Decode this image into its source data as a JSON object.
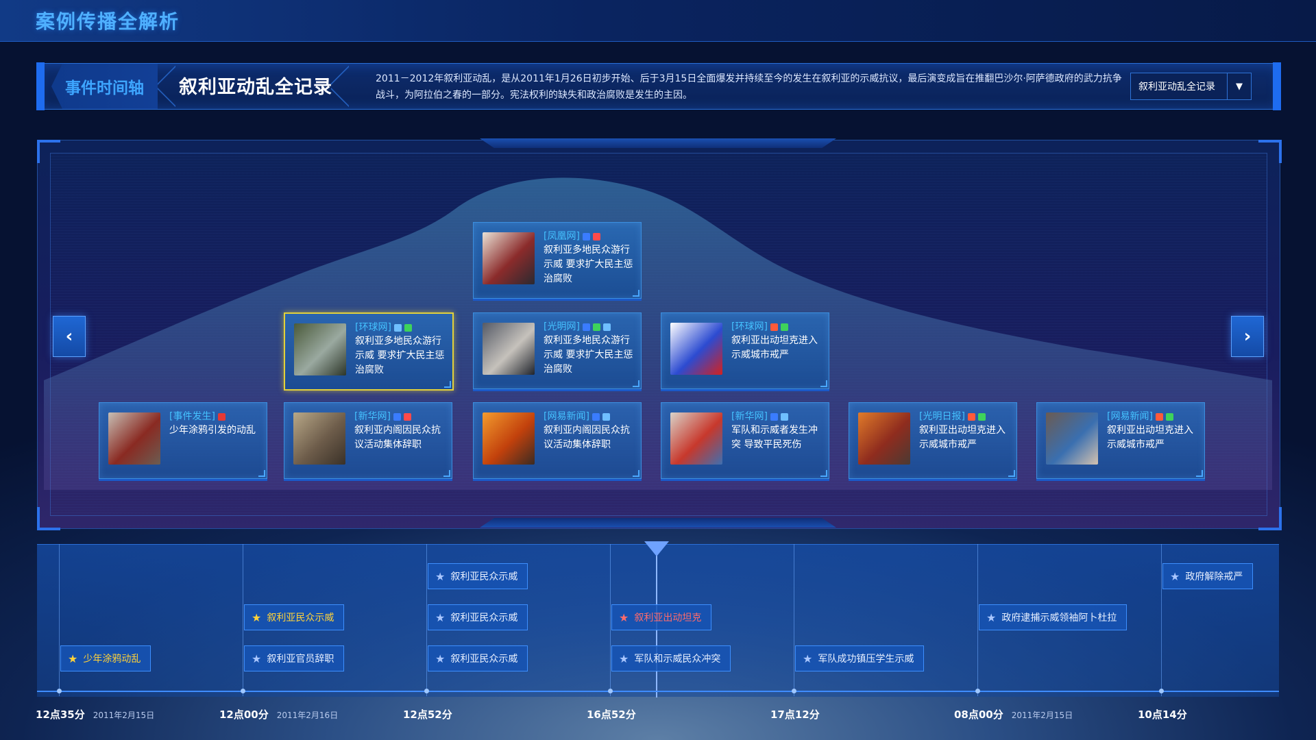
{
  "header": {
    "title": "案例传播全解析"
  },
  "event_bar": {
    "tab_label": "事件时间轴",
    "event_title": "叙利亚动乱全记录",
    "description": "2011－2012年叙利亚动乱，是从2011年1月26日初步开始、后于3月15日全面爆发并持续至今的发生在叙利亚的示威抗议，最后演变成旨在推翻巴沙尔·阿萨德政府的武力抗争战斗，为阿拉伯之春的一部分。宪法权利的缺失和政治腐败是发生的主因。",
    "select_value": "叙利亚动乱全记录",
    "select_arrow_icon": "caret-down-icon"
  },
  "nav": {
    "prev_icon": "chevron-left-icon",
    "next_icon": "chevron-right-icon"
  },
  "cards": [
    {
      "source": "[凤凰网]",
      "text": "叙利亚多地民众游行示威 要求扩大民主惩治腐败",
      "icons": [
        "#3a7cff",
        "#ff4a4a"
      ],
      "thumb": [
        "#e9e2d6",
        "#8b2b2b",
        "#2a2a30"
      ],
      "highlighted": false
    },
    {
      "source": "[环球网]",
      "text": "叙利亚多地民众游行示威 要求扩大民主惩治腐败",
      "icons": [
        "#6fbfff",
        "#3ed35b"
      ],
      "thumb": [
        "#4a5a3a",
        "#9aa9a0",
        "#2c3528"
      ],
      "highlighted": true
    },
    {
      "source": "[光明网]",
      "text": "叙利亚多地民众游行示威 要求扩大民主惩治腐败",
      "icons": [
        "#3a7cff",
        "#3ed35b",
        "#6fbfff"
      ],
      "thumb": [
        "#555a66",
        "#c6c2bc",
        "#1f232b"
      ],
      "highlighted": false
    },
    {
      "source": "[环球网]",
      "text": "叙利亚出动坦克进入示威城市戒严",
      "icons": [
        "#ff5a3a",
        "#3ed35b"
      ],
      "thumb": [
        "#ffffff",
        "#2c4bd1",
        "#d3211f"
      ],
      "highlighted": false
    },
    {
      "source": "[事件发生]",
      "text": "少年涂鸦引发的动乱",
      "icons": [
        "#e53935"
      ],
      "thumb": [
        "#c7bfb5",
        "#8a2a22",
        "#6b5d52"
      ],
      "highlighted": false
    },
    {
      "source": "[新华网]",
      "text": "叙利亚内阁因民众抗议活动集体辞职",
      "icons": [
        "#3a7cff",
        "#ff4a4a"
      ],
      "thumb": [
        "#b8a888",
        "#6d5c4a",
        "#3a3128"
      ],
      "highlighted": false
    },
    {
      "source": "[网易新闻]",
      "text": "叙利亚内阁因民众抗议活动集体辞职",
      "icons": [
        "#3a7cff",
        "#6fbfff"
      ],
      "thumb": [
        "#f39b2e",
        "#c2410c",
        "#3b2b22"
      ],
      "highlighted": false
    },
    {
      "source": "[新华网]",
      "text": "军队和示威者发生冲突 导致平民死伤",
      "icons": [
        "#3a7cff",
        "#6fbfff"
      ],
      "thumb": [
        "#d9d3c9",
        "#c8382c",
        "#3f6fb0"
      ],
      "highlighted": false
    },
    {
      "source": "[光明日报]",
      "text": "叙利亚出动坦克进入示威城市戒严",
      "icons": [
        "#ff5a3a",
        "#3ed35b"
      ],
      "thumb": [
        "#e07b2a",
        "#8f2c1e",
        "#4b3a33"
      ],
      "highlighted": false
    },
    {
      "source": "[网易新闻]",
      "text": "叙利亚出动坦克进入示威城市戒严",
      "icons": [
        "#ff5a3a",
        "#3ed35b"
      ],
      "thumb": [
        "#6b5b52",
        "#3a6fb0",
        "#d4c2b0"
      ],
      "highlighted": false
    }
  ],
  "timeline": {
    "tags": [
      {
        "label": "少年涂鸦动乱",
        "style": "gold"
      },
      {
        "label": "叙利亚民众示威",
        "style": "gold"
      },
      {
        "label": "叙利亚官员辞职",
        "style": "normal"
      },
      {
        "label": "叙利亚民众示威",
        "style": "normal"
      },
      {
        "label": "叙利亚民众示威",
        "style": "normal"
      },
      {
        "label": "叙利亚民众示威",
        "style": "normal"
      },
      {
        "label": "叙利亚出动坦克",
        "style": "red"
      },
      {
        "label": "军队和示威民众冲突",
        "style": "normal"
      },
      {
        "label": "军队成功镇压学生示威",
        "style": "normal"
      },
      {
        "label": "政府逮捕示威领袖阿卜杜拉",
        "style": "normal"
      },
      {
        "label": "政府解除戒严",
        "style": "normal"
      }
    ],
    "ticks": [
      {
        "time": "12点35分",
        "date": "2011年2月15日"
      },
      {
        "time": "12点00分",
        "date": "2011年2月16日"
      },
      {
        "time": "12点52分",
        "date": ""
      },
      {
        "time": "16点52分",
        "date": ""
      },
      {
        "time": "17点12分",
        "date": ""
      },
      {
        "time": "08点00分",
        "date": "2011年2月15日"
      },
      {
        "time": "10点14分",
        "date": ""
      }
    ],
    "star_icon": "star-icon"
  },
  "colors": {
    "accent": "#3ea6ff",
    "highlight": "#e3d13a",
    "alert": "#ff6b6b",
    "gold": "#ffd23a"
  }
}
